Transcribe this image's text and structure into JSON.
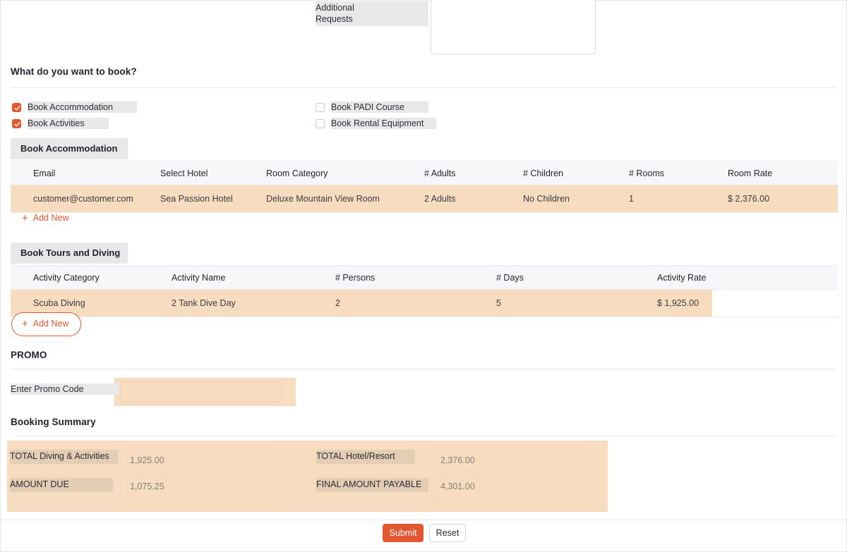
{
  "top_section": {
    "additional_requests_label": "Additional Requests",
    "additional_requests_value": ""
  },
  "booking_question": {
    "heading": "What do you want to book?",
    "options": [
      {
        "label": "Book Accommodation",
        "checked": true
      },
      {
        "label": "Book Activities",
        "checked": true
      },
      {
        "label": "Book PADI Course",
        "checked": false
      },
      {
        "label": "Book Rental Equipment",
        "checked": false
      }
    ]
  },
  "accommodation": {
    "tab_label": "Book Accommodation",
    "columns": [
      "Email",
      "Select Hotel",
      "Room Category",
      "# Adults",
      "# Children",
      "# Rooms",
      "Room Rate"
    ],
    "rows": [
      {
        "email": "customer@customer.com",
        "hotel": "Sea Passion Hotel",
        "room_category": "Deluxe Mountain View Room",
        "adults": "2 Adults",
        "children": "No Children",
        "rooms": "1",
        "room_rate": "$ 2,376.00"
      }
    ],
    "add_new_label": "Add New"
  },
  "tours": {
    "tab_label": "Book Tours and Diving",
    "columns": [
      "Activity Category",
      "Activity Name",
      "# Persons",
      "# Days",
      "Activity Rate"
    ],
    "rows": [
      {
        "category": "Scuba Diving",
        "name": "2 Tank Dive Day",
        "persons": "2",
        "days": "5",
        "rate": "$ 1,925.00"
      }
    ],
    "add_new_label": "Add New"
  },
  "promo": {
    "heading": "PROMO",
    "label": "Enter Promo Code",
    "value": "",
    "placeholder": ""
  },
  "summary": {
    "heading": "Booking Summary",
    "fields": [
      {
        "label": "TOTAL Diving & Activities",
        "value": "1,925.00"
      },
      {
        "label": "TOTAL Hotel/Resort",
        "value": "2,376.00"
      },
      {
        "label": "AMOUNT DUE",
        "value": "1,075.25"
      },
      {
        "label": "FINAL AMOUNT PAYABLE",
        "value": "4,301.00"
      }
    ]
  },
  "footer": {
    "submit_label": "Submit",
    "reset_label": "Reset"
  },
  "colors": {
    "accent": "#e2572f",
    "row_highlight": "#f8dcc0",
    "label_chip": "#e8e8e8",
    "summary_panel": "#f8dcc0",
    "summary_label": "#e4cdb5"
  }
}
